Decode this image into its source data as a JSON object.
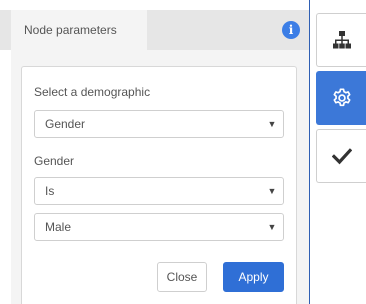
{
  "panel": {
    "tab_label": "Node parameters",
    "info_icon": "i"
  },
  "form": {
    "demographic_label": "Select a demographic",
    "demographic_value": "Gender",
    "condition_label": "Gender",
    "operator_value": "Is",
    "value_value": "Male",
    "caret": "▼"
  },
  "buttons": {
    "close_label": "Close",
    "apply_label": "Apply"
  },
  "rail": {
    "items": [
      {
        "icon": "hierarchy-icon",
        "active": false
      },
      {
        "icon": "gear-icon",
        "active": true
      },
      {
        "icon": "checkmark-icon",
        "active": false
      }
    ]
  },
  "colors": {
    "accent": "#3c78d8",
    "apply_button": "#2f6fd6",
    "info_icon": "#3c7ee6"
  }
}
